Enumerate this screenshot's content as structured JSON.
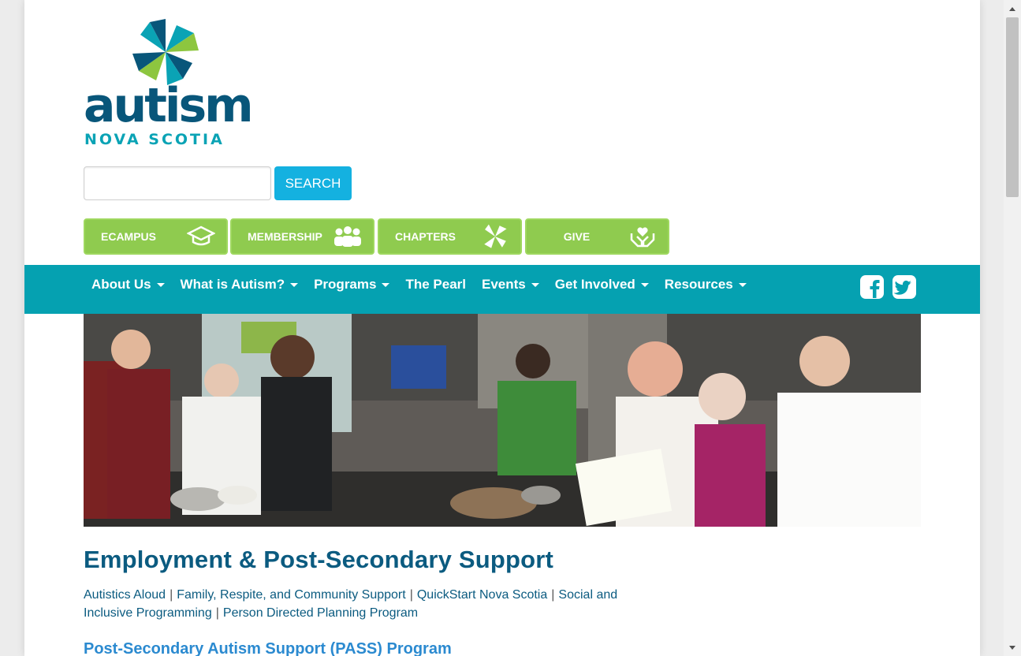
{
  "logo": {
    "word": "autism",
    "sub": "NOVA SCOTIA",
    "colors": {
      "navy": "#08567a",
      "teal": "#0aa3b5",
      "green": "#8dc63f"
    }
  },
  "search": {
    "placeholder": "",
    "value": "",
    "button_label": "SEARCH"
  },
  "quick_links": [
    {
      "label": "ECAMPUS",
      "icon": "graduation-cap-icon"
    },
    {
      "label": "MEMBERSHIP",
      "icon": "people-icon"
    },
    {
      "label": "CHAPTERS",
      "icon": "pinwheel-icon"
    },
    {
      "label": "GIVE",
      "icon": "hands-heart-icon"
    }
  ],
  "nav": {
    "items": [
      {
        "label": "About Us",
        "dropdown": true
      },
      {
        "label": "What is Autism?",
        "dropdown": true
      },
      {
        "label": "Programs",
        "dropdown": true
      },
      {
        "label": "The Pearl",
        "dropdown": false
      },
      {
        "label": "Events",
        "dropdown": true
      },
      {
        "label": "Get Involved",
        "dropdown": true
      },
      {
        "label": "Resources",
        "dropdown": true
      }
    ],
    "social": [
      "facebook-icon",
      "twitter-icon"
    ],
    "color": "#05a1b1"
  },
  "main": {
    "title": "Employment & Post-Secondary Support",
    "subnav": [
      "Autistics Aloud",
      "Family, Respite, and Community Support",
      "QuickStart Nova Scotia",
      "Social and Inclusive Programming",
      "Person Directed Planning Program"
    ],
    "section_title": "Post-Secondary Autism Support (PASS) Program"
  }
}
